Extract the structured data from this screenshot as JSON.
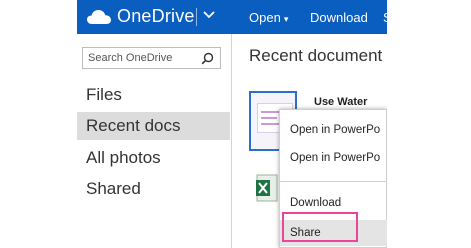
{
  "header": {
    "brand": "OneDrive",
    "commands": [
      {
        "label": "Open"
      },
      {
        "label": "Download"
      },
      {
        "label": "S"
      }
    ]
  },
  "sidebar": {
    "search_placeholder": "Search OneDrive",
    "items": [
      {
        "label": "Files"
      },
      {
        "label": "Recent docs",
        "selected": true
      },
      {
        "label": "All photos"
      },
      {
        "label": "Shared"
      }
    ]
  },
  "main": {
    "heading": "Recent document",
    "documents": [
      {
        "title": "Use Water"
      }
    ]
  },
  "context_menu": {
    "items": [
      {
        "label": "Open in PowerPo"
      },
      {
        "label": "Open in PowerPo"
      },
      {
        "label": "Download"
      },
      {
        "label": "Share"
      }
    ]
  },
  "colors": {
    "accent": "#0a5ec0",
    "highlight_box": "#e8459b",
    "selected_nav": "#dcdcdc"
  }
}
